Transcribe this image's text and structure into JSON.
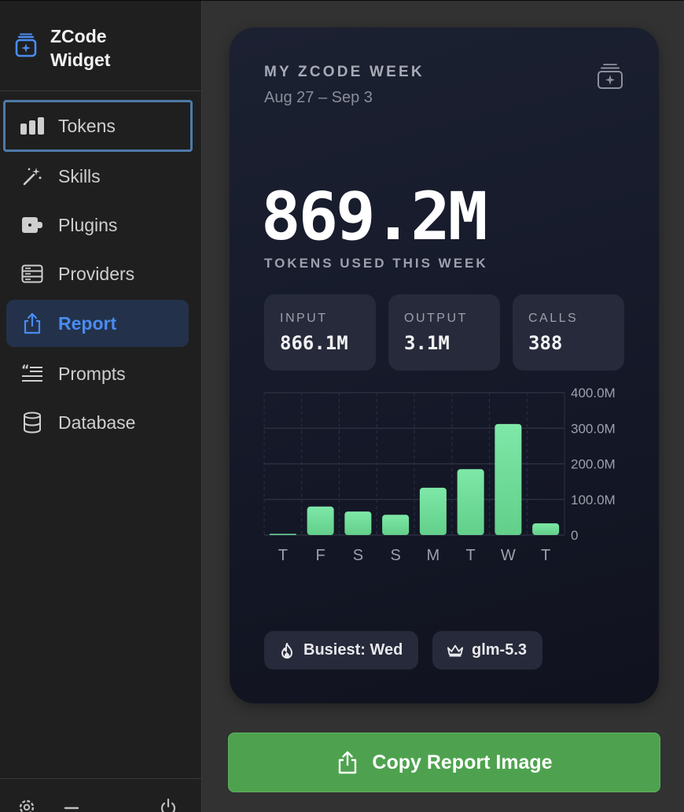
{
  "app": {
    "name": "ZCode\nWidget"
  },
  "sidebar": {
    "items": [
      {
        "label": "Tokens",
        "icon": "bar-chart-icon"
      },
      {
        "label": "Skills",
        "icon": "magic-wand-icon"
      },
      {
        "label": "Plugins",
        "icon": "plugin-icon"
      },
      {
        "label": "Providers",
        "icon": "server-icon"
      },
      {
        "label": "Report",
        "icon": "share-icon"
      },
      {
        "label": "Prompts",
        "icon": "quote-list-icon"
      },
      {
        "label": "Database",
        "icon": "database-icon"
      }
    ],
    "active": "Report",
    "focused": "Tokens",
    "bottom_icons": [
      "gear-icon",
      "minimize-icon",
      "power-icon"
    ]
  },
  "report": {
    "title": "MY ZCODE WEEK",
    "date_range": "Aug 27 – Sep 3",
    "total": "869.2M",
    "total_caption": "TOKENS USED THIS WEEK",
    "stats": [
      {
        "label": "INPUT",
        "value": "866.1M"
      },
      {
        "label": "OUTPUT",
        "value": "3.1M"
      },
      {
        "label": "CALLS",
        "value": "388"
      }
    ],
    "busiest": "Busiest: Wed",
    "top_model": "glm-5.3"
  },
  "chart_data": {
    "type": "bar",
    "categories": [
      "T",
      "F",
      "S",
      "S",
      "M",
      "T",
      "W",
      "T"
    ],
    "values": [
      1,
      80,
      66,
      57,
      133,
      185,
      312,
      33
    ],
    "y_unit": "M tokens",
    "ylim": [
      0,
      400
    ],
    "yticks": [
      "400.0M",
      "300.0M",
      "200.0M",
      "100.0M",
      "0"
    ],
    "ytick_values": [
      400,
      300,
      200,
      100,
      0
    ],
    "grid": true,
    "bar_color": "#7ee8a8"
  },
  "actions": {
    "copy_label": "Copy Report Image"
  },
  "colors": {
    "accent": "#4a8bf2",
    "button": "#4ea24f",
    "bar": "#7ee8a8"
  }
}
